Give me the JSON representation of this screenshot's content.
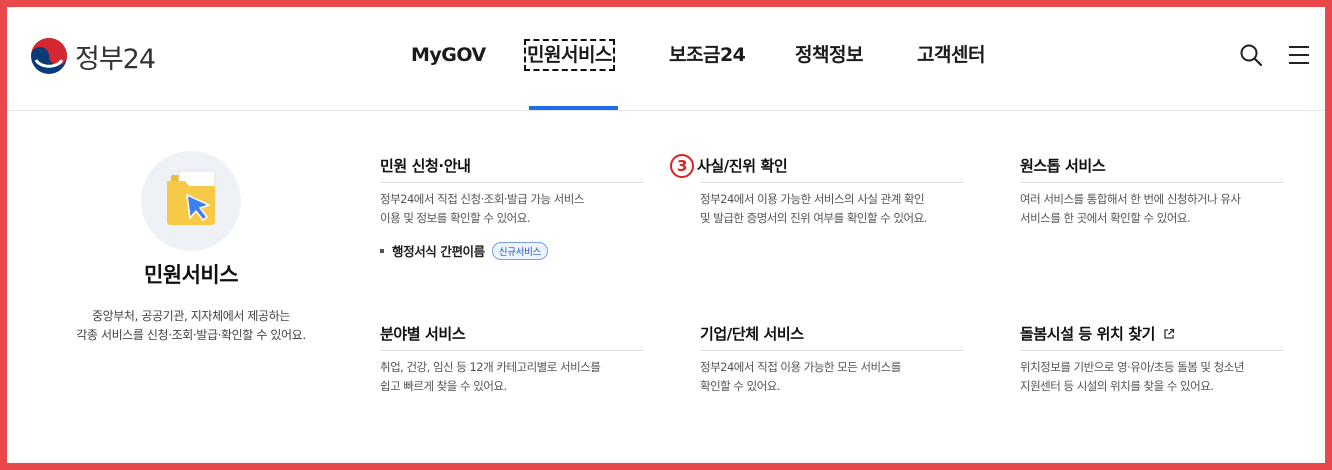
{
  "logo": {
    "text": "정부24"
  },
  "nav": {
    "items": [
      {
        "label": "MyGOV"
      },
      {
        "label": "민원서비스"
      },
      {
        "label": "보조금24"
      },
      {
        "label": "정책정보"
      },
      {
        "label": "고객센터"
      }
    ],
    "active_index": 1
  },
  "util": {
    "search_icon": "search-icon",
    "menu_icon": "hamburger-menu-icon"
  },
  "intro": {
    "title": "민원서비스",
    "desc_line1": "중앙부처, 공공기관, 지자체에서 제공하는",
    "desc_line2": "각종 서비스를 신청·조회·발급·확인할 수 있어요."
  },
  "menu": {
    "apply": {
      "title": "민원 신청·안내",
      "desc": "정부24에서 직접 신청·조회·발급 가능 서비스\n이용 및 정보를 확인할 수 있어요.",
      "sub_link": "행정서식 간편이름",
      "sub_tag": "신규서비스"
    },
    "verify": {
      "badge": "3",
      "title": "사실/진위 확인",
      "desc": "정부24에서 이용 가능한 서비스의 사실 관계 확인\n및 발급한 증명서의 진위 여부를 확인할 수 있어요."
    },
    "onestop": {
      "title": "원스톱 서비스",
      "desc": "여러 서비스를 통합해서 한 번에 신청하거나 유사\n서비스를 한 곳에서 확인할 수 있어요."
    },
    "category": {
      "title": "분야별 서비스",
      "desc": "취업, 건강, 임신 등 12개 카테고리별로 서비스를\n쉽고 빠르게 찾을 수 있어요."
    },
    "business": {
      "title": "기업/단체 서비스",
      "desc": "정부24에서 직접 이용 가능한 모든 서비스를\n확인할 수 있어요."
    },
    "care": {
      "title": "돌봄시설 등 위치 찾기",
      "desc": "위치정보를 기반으로 영·유아/초등 돌봄 및 청소년\n지원센터 등 시설의 위치를 찾을 수 있어요."
    }
  },
  "colors": {
    "accent": "#1e6ee8",
    "frame": "#e8484a",
    "badge": "#e02020"
  }
}
